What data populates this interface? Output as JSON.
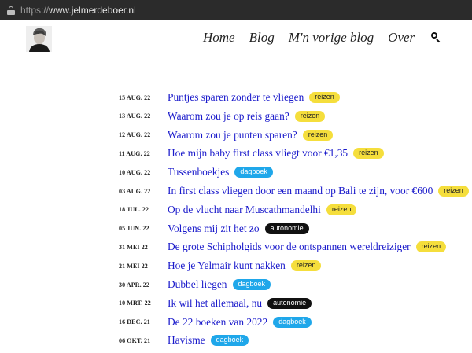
{
  "browser": {
    "url_scheme": "https://",
    "url_host": "www.jelmerdeboer.nl"
  },
  "header": {
    "nav": [
      "Home",
      "Blog",
      "M'n vorige blog",
      "Over"
    ],
    "search_icon": "search-icon"
  },
  "posts": [
    {
      "date": "15 AUG. 22",
      "title": "Puntjes sparen zonder te vliegen",
      "tag": "reizen"
    },
    {
      "date": "13 AUG. 22",
      "title": "Waarom zou je op reis gaan?",
      "tag": "reizen"
    },
    {
      "date": "12 AUG. 22",
      "title": "Waarom zou je punten sparen?",
      "tag": "reizen"
    },
    {
      "date": "11 AUG. 22",
      "title": "Hoe mijn baby first class vliegt voor €1,35",
      "tag": "reizen"
    },
    {
      "date": "10 AUG. 22",
      "title": "Tussenboekjes",
      "tag": "dagboek"
    },
    {
      "date": "03 AUG. 22",
      "title": "In first class vliegen door een maand op Bali te zijn, voor €600",
      "tag": "reizen"
    },
    {
      "date": "18 JUL. 22",
      "title": "Op de vlucht naar Muscathmandelhi",
      "tag": "reizen"
    },
    {
      "date": "05 JUN. 22",
      "title": "Volgens mij zit het zo",
      "tag": "autonomie"
    },
    {
      "date": "31 MEI 22",
      "title": "De grote Schipholgids voor de ontspannen wereldreiziger",
      "tag": "reizen"
    },
    {
      "date": "21 MEI 22",
      "title": "Hoe je Yelmair kunt nakken",
      "tag": "reizen"
    },
    {
      "date": "30 APR. 22",
      "title": "Dubbel liegen",
      "tag": "dagboek"
    },
    {
      "date": "10 MRT. 22",
      "title": "Ik wil het allemaal, nu",
      "tag": "autonomie"
    },
    {
      "date": "16 DEC. 21",
      "title": "De 22 boeken van 2022",
      "tag": "dagboek"
    },
    {
      "date": "06 OKT. 21",
      "title": "Havisme",
      "tag": "dagboek"
    }
  ],
  "colors": {
    "reizen": "#f5de3c",
    "dagboek": "#1fa7ea",
    "autonomie": "#111111",
    "link": "#1a1acb"
  }
}
